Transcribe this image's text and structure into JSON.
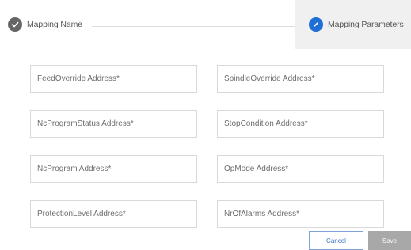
{
  "stepper": {
    "steps": [
      {
        "label": "Mapping Name",
        "status": "completed",
        "icon": "check-icon"
      },
      {
        "label": "Mapping Parameters",
        "status": "active",
        "icon": "pencil-icon"
      }
    ]
  },
  "form": {
    "fields": [
      {
        "placeholder": "FeedOverride Address*"
      },
      {
        "placeholder": "SpindleOverride Address*"
      },
      {
        "placeholder": "NcProgramStatus Address*"
      },
      {
        "placeholder": "StopCondition Address*"
      },
      {
        "placeholder": "NcProgram Address*"
      },
      {
        "placeholder": "OpMode Address*"
      },
      {
        "placeholder": "ProtectionLevel Address*"
      },
      {
        "placeholder": "NrOfAlarms Address*"
      }
    ]
  },
  "actions": {
    "cancel_label": "Cancel",
    "save_label": "Save"
  },
  "colors": {
    "accent": "#1f6fd6",
    "completed_step": "#666666",
    "save_disabled": "#a8a8a8"
  }
}
